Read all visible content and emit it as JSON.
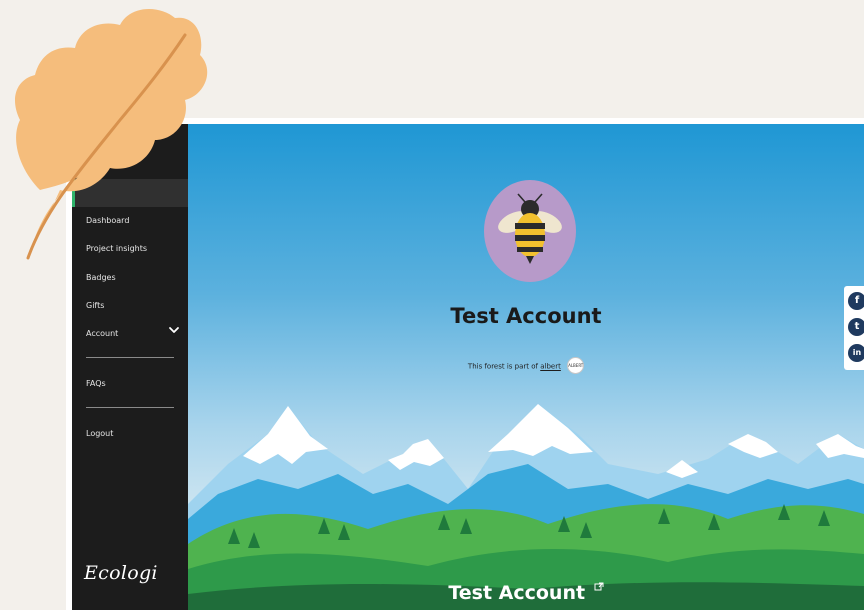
{
  "sidebar": {
    "items": [
      {
        "label": "Dashboard"
      },
      {
        "label": "Project insights"
      },
      {
        "label": "Badges"
      },
      {
        "label": "Gifts"
      },
      {
        "label": "Account"
      },
      {
        "label": "FAQs"
      },
      {
        "label": "Logout"
      }
    ],
    "brand": "Ecologi"
  },
  "profile": {
    "name": "Test Account",
    "forest_prefix": "This forest is part of",
    "forest_link": "albert",
    "partner_logo_text": "ALBERT"
  },
  "footer_banner": {
    "title": "Test Account"
  },
  "social": [
    {
      "icon": "facebook-icon",
      "glyph": "f"
    },
    {
      "icon": "twitter-icon",
      "glyph": "t"
    },
    {
      "icon": "linkedin-icon",
      "glyph": "in"
    }
  ],
  "colors": {
    "leaf": "#f5bd7c",
    "sidebar_bg": "#1c1c1c",
    "sky_top": "#1f97d4",
    "accent_green": "#2fb36b",
    "avatar_bg": "#b79ac9"
  }
}
